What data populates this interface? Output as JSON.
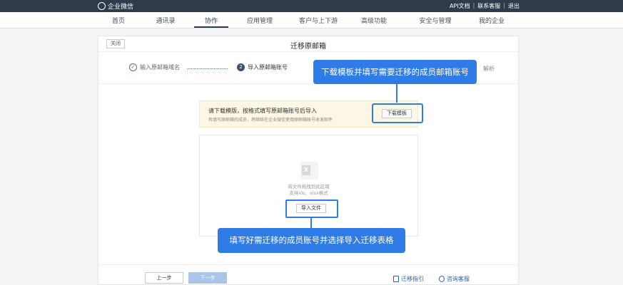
{
  "topbar": {
    "brand": "企业微信",
    "links": [
      "API文档",
      "联系客服",
      "退出"
    ]
  },
  "nav": {
    "items": [
      "首页",
      "通讯录",
      "协作",
      "应用管理",
      "客户与上下游",
      "高级功能",
      "安全与管理",
      "我的企业"
    ],
    "active": "协作"
  },
  "card": {
    "close_label": "关闭",
    "title": "迁移原邮箱"
  },
  "steps": {
    "step1": "输入原邮箱域名",
    "step2_num": "2",
    "step2": "导入原邮箱账号",
    "step3_tail": "解析"
  },
  "notice": {
    "title": "请下载模版，按格式填写原邮箱账号后导入",
    "subtitle": "有填写原邮箱的成员，将继续在企业微信使用原邮箱账号收发邮件",
    "download_label": "下载模板"
  },
  "dropzone": {
    "icon_letter": "X",
    "text1": "将文件拖拽到此区域",
    "text2": "支持xls、xlsx格式",
    "import_label": "导入文件"
  },
  "footer": {
    "prev_label": "上一步",
    "next_label": "下一步",
    "guide_label": "迁移指引",
    "service_label": "咨询客服"
  },
  "callouts": {
    "download_hint": "下载模板并填写需要迁移的成员邮箱账号",
    "import_hint": "填写好需迁移的成员账号并选择导入迁移表格"
  },
  "colors": {
    "topbar": "#2f3a4b",
    "highlight": "#2f7ce6",
    "notice_bg": "#fcf6e4",
    "link": "#2f5f9e"
  }
}
